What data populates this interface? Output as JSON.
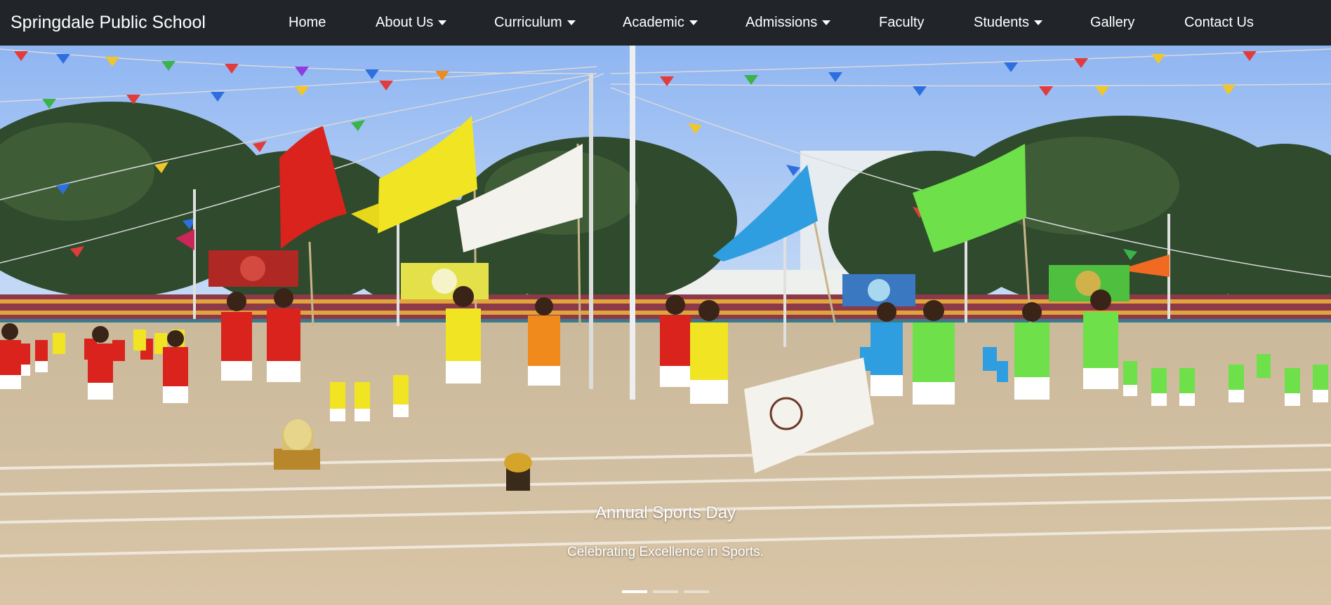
{
  "navbar": {
    "brand": "Springdale Public School",
    "items": [
      {
        "label": "Home",
        "dropdown": false
      },
      {
        "label": "About Us",
        "dropdown": true
      },
      {
        "label": "Curriculum",
        "dropdown": true
      },
      {
        "label": "Academic",
        "dropdown": true
      },
      {
        "label": "Admissions",
        "dropdown": true
      },
      {
        "label": "Faculty",
        "dropdown": false
      },
      {
        "label": "Students",
        "dropdown": true
      },
      {
        "label": "Gallery",
        "dropdown": false
      },
      {
        "label": "Contact Us",
        "dropdown": false
      }
    ]
  },
  "carousel": {
    "caption_title": "Annual Sports Day",
    "caption_text": "Celebrating Excellence in Sports.",
    "slides": 3,
    "active_index": 0
  },
  "colors": {
    "navbar_bg": "#212529",
    "team_red": "#d9231c",
    "team_yellow": "#f1e423",
    "team_blue": "#2e9ee0",
    "team_green": "#6ee04a",
    "team_orange": "#f08a1c"
  }
}
